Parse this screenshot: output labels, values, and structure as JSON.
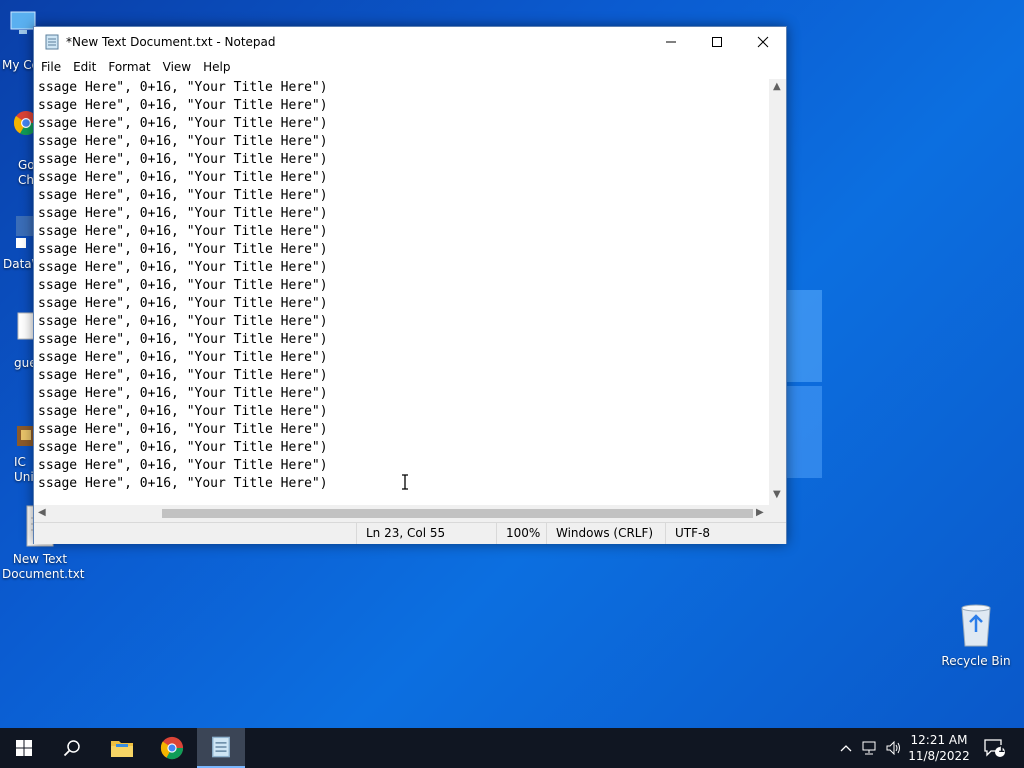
{
  "desktop": {
    "icons": [
      {
        "label": "My Co",
        "name": "this-pc"
      },
      {
        "label": "Go Ch",
        "name": "google-chrome"
      },
      {
        "label": "DataW",
        "name": "datawrapper"
      },
      {
        "label": "gue",
        "name": "guest-file"
      },
      {
        "label": "IC Uni",
        "name": "ic-uninstall"
      },
      {
        "label": "New Text Document.txt",
        "name": "new-text-document"
      }
    ],
    "recycle_bin_label": "Recycle Bin"
  },
  "notepad": {
    "title": "*New Text Document.txt - Notepad",
    "menu": [
      "File",
      "Edit",
      "Format",
      "View",
      "Help"
    ],
    "line_text": "ssage Here\", 0+16, \"Your Title Here\")",
    "line_count": 23,
    "status": {
      "position": "Ln 23, Col 55",
      "zoom": "100%",
      "line_ending": "Windows (CRLF)",
      "encoding": "UTF-8"
    }
  },
  "taskbar": {
    "apps": [
      "start-icon",
      "search-icon",
      "file-explorer-icon",
      "chrome-icon",
      "notepad-icon"
    ],
    "clock_time": "12:21 AM",
    "clock_date": "11/8/2022",
    "notification_count": "1"
  },
  "colors": {
    "desktop": "#0b5bd0",
    "taskbar": "#101622",
    "active_task": "#3b4556"
  }
}
